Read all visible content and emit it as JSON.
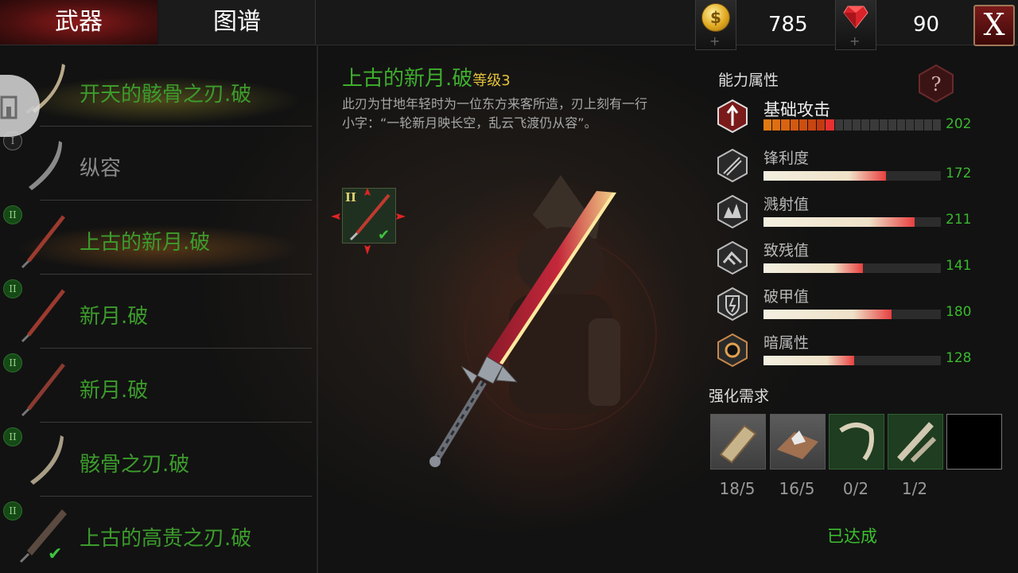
{
  "tabs": {
    "weapons": "武器",
    "atlas": "图谱"
  },
  "currency": {
    "coins": "785",
    "gems": "90",
    "close": "X"
  },
  "weapon_list": [
    {
      "name": "开天的骸骨之刃.破",
      "tier": "",
      "style": "green",
      "selected": true
    },
    {
      "name": "纵容",
      "tier": "I",
      "style": "gray",
      "selected": false
    },
    {
      "name": "上古的新月.破",
      "tier": "II",
      "style": "green",
      "selected": false
    },
    {
      "name": "新月.破",
      "tier": "II",
      "style": "green",
      "selected": false
    },
    {
      "name": "新月.破",
      "tier": "II",
      "style": "green",
      "selected": false
    },
    {
      "name": "骸骨之刃.破",
      "tier": "II",
      "style": "green",
      "selected": false
    },
    {
      "name": "上古的高贵之刃.破",
      "tier": "II",
      "style": "green",
      "selected": false
    }
  ],
  "detail": {
    "name": "上古的新月.破",
    "level": "等级3",
    "description": "此刃为甘地年轻时为一位东方来客所造，刃上刻有一行小字：“一轮新月映长空，乱云飞渡仍从容”。",
    "slot_tier": "II"
  },
  "stats": {
    "title": "能力属性",
    "items": [
      {
        "label": "基础攻击",
        "value": "202",
        "icon": "base-attack-icon",
        "fill": 0.4
      },
      {
        "label": "锋利度",
        "value": "172",
        "icon": "sharpness-icon",
        "fill": 0.69
      },
      {
        "label": "溅射值",
        "value": "211",
        "icon": "splash-icon",
        "fill": 0.85
      },
      {
        "label": "致残值",
        "value": "141",
        "icon": "cripple-icon",
        "fill": 0.56
      },
      {
        "label": "破甲值",
        "value": "180",
        "icon": "armor-break-icon",
        "fill": 0.72
      },
      {
        "label": "暗属性",
        "value": "128",
        "icon": "dark-attribute-icon",
        "fill": 0.51
      }
    ]
  },
  "upgrade": {
    "title": "强化需求",
    "materials": [
      {
        "count": "18/5",
        "icon": "wood-material-icon"
      },
      {
        "count": "16/5",
        "icon": "ore-material-icon"
      },
      {
        "count": "0/2",
        "icon": "claw-material-icon"
      },
      {
        "count": "1/2",
        "icon": "bone-material-icon"
      },
      {
        "count": "",
        "icon": "empty-slot"
      }
    ],
    "status": "已达成"
  },
  "colors": {
    "accent_green": "#3fae2e",
    "level_yellow": "#e2c33a",
    "tab_red": "#8a1a1a"
  }
}
